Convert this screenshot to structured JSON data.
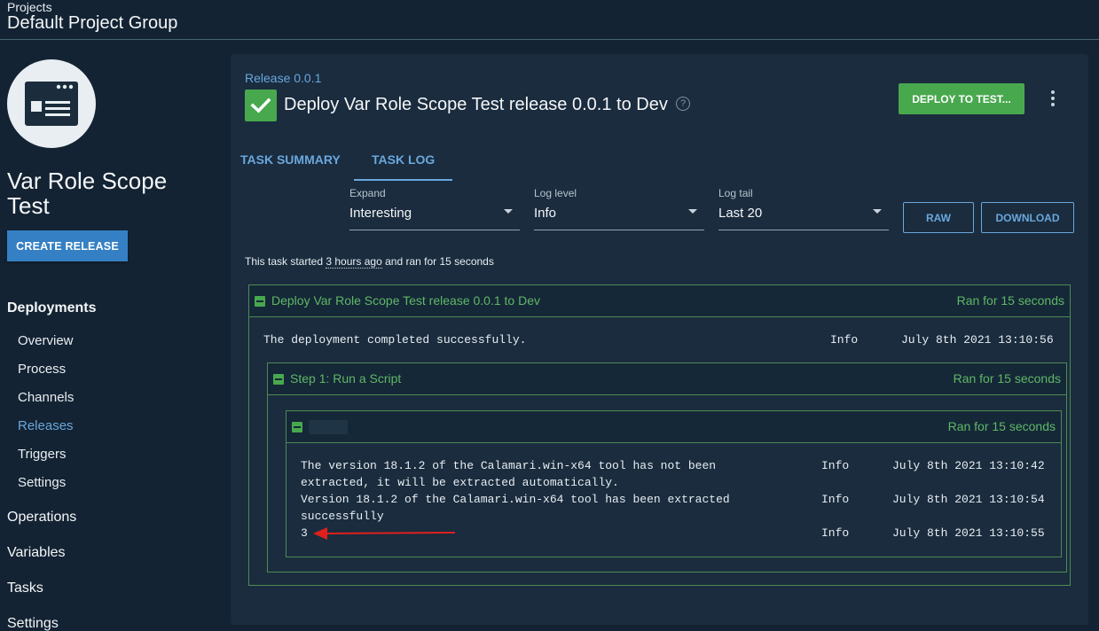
{
  "header": {
    "breadcrumb": "Projects",
    "group": "Default Project Group"
  },
  "sidebar": {
    "project_name": "Var Role Scope Test",
    "create_release": "CREATE RELEASE",
    "deployments": "Deployments",
    "sub_items": [
      "Overview",
      "Process",
      "Channels",
      "Releases",
      "Triggers",
      "Settings"
    ],
    "active_item": "Releases",
    "sections": [
      "Operations",
      "Variables",
      "Tasks",
      "Settings"
    ]
  },
  "card": {
    "release_link": "Release 0.0.1",
    "title": "Deploy Var Role Scope Test release 0.0.1 to Dev",
    "help": "?",
    "deploy_button": "DEPLOY TO TEST...",
    "tabs": {
      "summary": "TASK SUMMARY",
      "log": "TASK LOG"
    },
    "filters": {
      "expand": {
        "label": "Expand",
        "value": "Interesting"
      },
      "log_level": {
        "label": "Log level",
        "value": "Info"
      },
      "log_tail": {
        "label": "Log tail",
        "value": "Last 20"
      }
    },
    "raw_button": "RAW",
    "download_button": "DOWNLOAD",
    "task_info": {
      "prefix": "This task started ",
      "ago": "3 hours ago",
      "suffix": " and ran for 15 seconds"
    }
  },
  "log": {
    "root": {
      "title": "Deploy Var Role Scope Test release 0.0.1 to Dev",
      "ran": "Ran for 15 seconds",
      "message": "The deployment completed successfully.",
      "level": "Info",
      "time": "July 8th 2021 13:10:56"
    },
    "step": {
      "title": "Step 1: Run a Script",
      "ran": "Ran for 15 seconds"
    },
    "target": {
      "ran": "Ran for 15 seconds",
      "entries": [
        {
          "line1": "The version 18.1.2 of the Calamari.win-x64 tool has not been",
          "line2": "extracted, it will be extracted automatically.",
          "level": "Info",
          "time": "July 8th 2021 13:10:42"
        },
        {
          "line1": "Version 18.1.2 of the Calamari.win-x64 tool has been extracted",
          "line2": "successfully",
          "level": "Info",
          "time": "July 8th 2021 13:10:54"
        },
        {
          "line1": "3",
          "line2": "",
          "level": "Info",
          "time": "July 8th 2021 13:10:55"
        }
      ]
    }
  },
  "colors": {
    "background": "#132333",
    "card": "#1a2c3e",
    "accent": "#6aa7dc",
    "success": "#48a84e",
    "annotation": "#e0201c"
  }
}
